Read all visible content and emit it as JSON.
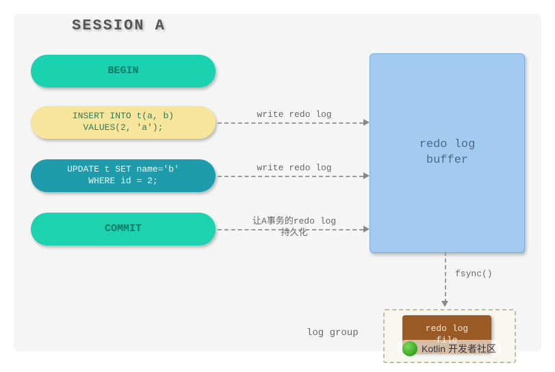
{
  "title": "SESSION A",
  "steps": {
    "begin": {
      "label": "BEGIN"
    },
    "insert": {
      "line1": "INSERT INTO t(a, b)",
      "line2": "VALUES(2, 'a');"
    },
    "update": {
      "line1": "UPDATE t SET name='b'",
      "line2": "WHERE id = 2;"
    },
    "commit": {
      "label": "COMMIT"
    }
  },
  "arrows": {
    "insert_label": "write redo log",
    "update_label": "write redo log",
    "commit_label_l1": "让A事务的redo log",
    "commit_label_l2": "持久化",
    "fsync_label": "fsync()"
  },
  "buffer": {
    "line1": "redo log",
    "line2": "buffer"
  },
  "loggroup": {
    "label": "log group"
  },
  "logfile": {
    "line1": "redo log",
    "line2": "file"
  },
  "watermark": {
    "text": "Kotlin 开发者社区"
  },
  "colors": {
    "teal": "#1ad1b0",
    "yellow": "#f6e59a",
    "dark_teal": "#1e9cab",
    "buffer_blue": "#a3cbf2",
    "file_brown": "#9a5a25"
  }
}
